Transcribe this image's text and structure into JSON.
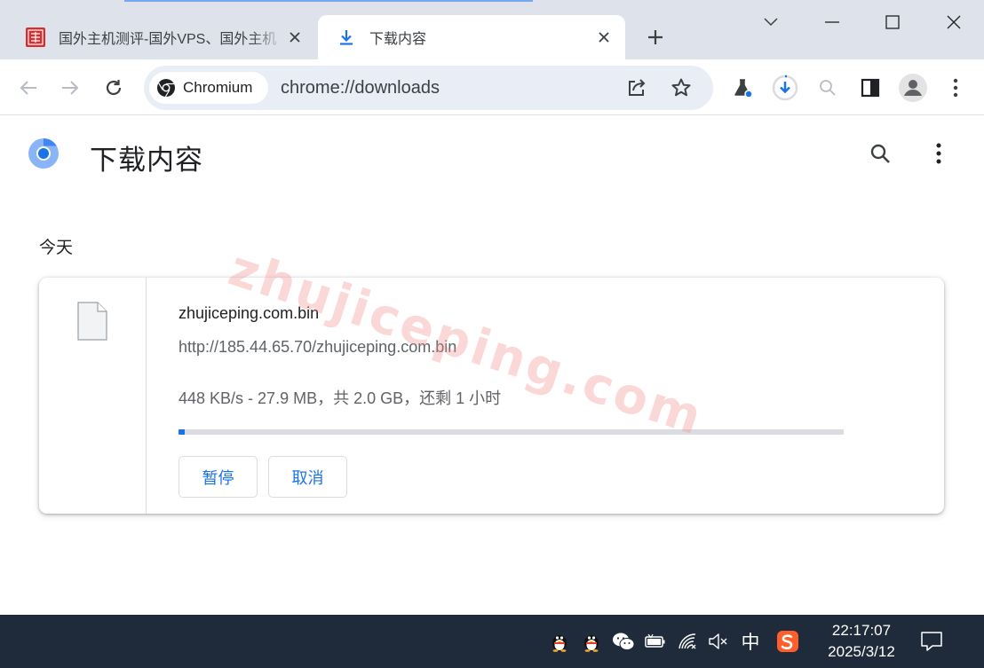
{
  "browser": {
    "tabs": [
      {
        "title": "国外主机测评-国外VPS、国外主机",
        "favicon": "site-seal-icon",
        "active": false
      },
      {
        "title": "下载内容",
        "favicon": "download-arrow-icon",
        "active": true
      }
    ],
    "chip_label": "Chromium",
    "url": "chrome://downloads"
  },
  "page": {
    "title": "下载内容",
    "date_group": "今天",
    "watermark": "zhujiceping.com"
  },
  "download": {
    "filename": "zhujiceping.com.bin",
    "url": "http://185.44.65.70/zhujiceping.com.bin",
    "status": "448 KB/s - 27.9 MB，共 2.0 GB，还剩 1 小时",
    "progress_percent": 1.0,
    "pause_label": "暂停",
    "cancel_label": "取消"
  },
  "taskbar": {
    "ime_label": "中",
    "time": "22:17:07",
    "date": "2025/3/12"
  },
  "colors": {
    "accent": "#1a73e8",
    "tabstrip": "#dee3eb",
    "taskbar": "#1f2a3a",
    "watermark": "#f48f8f"
  }
}
